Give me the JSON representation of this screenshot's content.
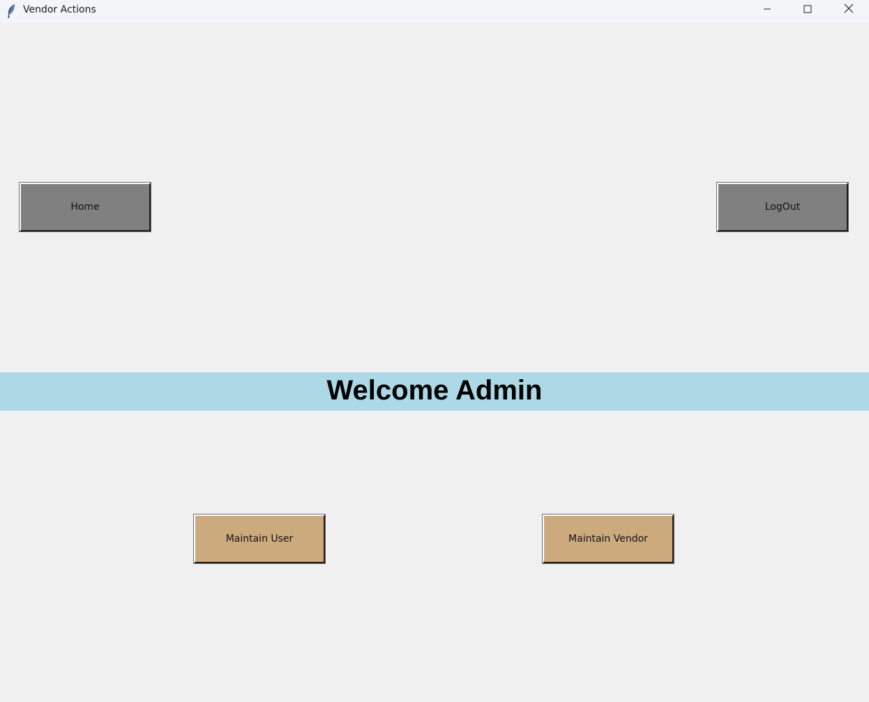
{
  "window": {
    "title": "Vendor Actions",
    "icon": "feather-icon",
    "controls": [
      "minimize-icon",
      "maximize-icon",
      "close-icon"
    ]
  },
  "nav": {
    "home_label": "Home",
    "logout_label": "LogOut"
  },
  "banner": {
    "text": "Welcome Admin"
  },
  "actions": {
    "maintain_user_label": "Maintain User",
    "maintain_vendor_label": "Maintain Vendor"
  },
  "colors": {
    "nav_button": "#808080",
    "action_button": "#cdaa7d",
    "banner": "#add8e6",
    "background": "#f0f0f0"
  }
}
